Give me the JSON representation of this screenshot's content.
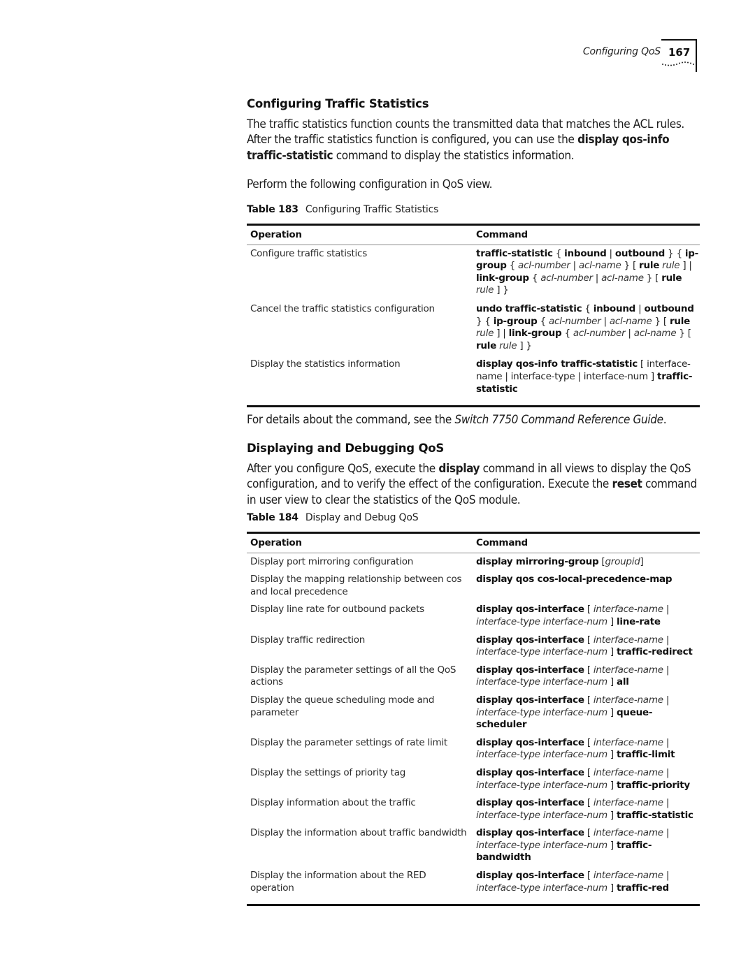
{
  "header": {
    "running_title": "Configuring QoS",
    "page_number": "167"
  },
  "section1": {
    "title": "Configuring Traffic Statistics",
    "intro": [
      {
        "t": "The traffic statistics function counts the transmitted data that matches the ACL rules. After the traffic statistics function is configured, you can use the ",
        "s": "n"
      },
      {
        "t": "display qos-info traffic-statistic",
        "s": "b"
      },
      {
        "t": " command to display the statistics information.",
        "s": "n"
      }
    ],
    "instruction": "Perform the following configuration in QoS view.",
    "table_label": "Table 183",
    "table_caption": "Configuring Traffic Statistics",
    "columns": [
      "Operation",
      "Command"
    ],
    "rows": [
      {
        "operation": "Configure traffic statistics",
        "command": [
          {
            "t": "traffic-statistic",
            "s": "b"
          },
          {
            "t": " { ",
            "s": "n"
          },
          {
            "t": "inbound",
            "s": "b"
          },
          {
            "t": " | ",
            "s": "n"
          },
          {
            "t": "outbound",
            "s": "b"
          },
          {
            "t": " } { ",
            "s": "n"
          },
          {
            "t": "ip-group",
            "s": "b"
          },
          {
            "t": " { ",
            "s": "n"
          },
          {
            "t": "acl-number",
            "s": "i"
          },
          {
            "t": " | ",
            "s": "n"
          },
          {
            "t": "acl-name",
            "s": "i"
          },
          {
            "t": " } [ ",
            "s": "n"
          },
          {
            "t": "rule",
            "s": "b"
          },
          {
            "t": " ",
            "s": "n"
          },
          {
            "t": "rule",
            "s": "i"
          },
          {
            "t": " ] | ",
            "s": "n"
          },
          {
            "t": "link-group",
            "s": "b"
          },
          {
            "t": " { ",
            "s": "n"
          },
          {
            "t": "acl-number",
            "s": "i"
          },
          {
            "t": " | ",
            "s": "n"
          },
          {
            "t": "acl-name",
            "s": "i"
          },
          {
            "t": " } [ ",
            "s": "n"
          },
          {
            "t": "rule",
            "s": "b"
          },
          {
            "t": " ",
            "s": "n"
          },
          {
            "t": "rule",
            "s": "i"
          },
          {
            "t": " ] }",
            "s": "n"
          }
        ]
      },
      {
        "operation": "Cancel the traffic statistics configuration",
        "command": [
          {
            "t": "undo traffic-statistic",
            "s": "b"
          },
          {
            "t": "  { ",
            "s": "n"
          },
          {
            "t": "inbound",
            "s": "b"
          },
          {
            "t": " | ",
            "s": "n"
          },
          {
            "t": "outbound",
            "s": "b"
          },
          {
            "t": " } { ",
            "s": "n"
          },
          {
            "t": "ip-group",
            "s": "b"
          },
          {
            "t": " { ",
            "s": "n"
          },
          {
            "t": "acl-number",
            "s": "i"
          },
          {
            "t": " | ",
            "s": "n"
          },
          {
            "t": "acl-name",
            "s": "i"
          },
          {
            "t": " } [ ",
            "s": "n"
          },
          {
            "t": "rule",
            "s": "b"
          },
          {
            "t": " ",
            "s": "n"
          },
          {
            "t": "rule",
            "s": "i"
          },
          {
            "t": " ] | ",
            "s": "n"
          },
          {
            "t": "link-group",
            "s": "b"
          },
          {
            "t": " { ",
            "s": "n"
          },
          {
            "t": "acl-number",
            "s": "i"
          },
          {
            "t": " | ",
            "s": "n"
          },
          {
            "t": "acl-name",
            "s": "i"
          },
          {
            "t": " } [ ",
            "s": "n"
          },
          {
            "t": "rule",
            "s": "b"
          },
          {
            "t": " ",
            "s": "n"
          },
          {
            "t": "rule",
            "s": "i"
          },
          {
            "t": " ] }",
            "s": "n"
          }
        ]
      },
      {
        "operation": "Display the statistics information",
        "command": [
          {
            "t": "display qos-info traffic-statistic",
            "s": "b"
          },
          {
            "t": " [ interface-name | interface-type | interface-num ] ",
            "s": "n"
          },
          {
            "t": "traffic-statistic",
            "s": "b"
          }
        ]
      }
    ],
    "reference": [
      {
        "t": "For details about the command, see the ",
        "s": "n"
      },
      {
        "t": "Switch 7750 Command Reference Guide",
        "s": "i"
      },
      {
        "t": ".",
        "s": "n"
      }
    ]
  },
  "section2": {
    "title": "Displaying and Debugging QoS",
    "intro": [
      {
        "t": "After you configure QoS, execute the ",
        "s": "n"
      },
      {
        "t": "display",
        "s": "b"
      },
      {
        "t": " command in all views to display the QoS configuration, and to verify the effect of the configuration. Execute the ",
        "s": "n"
      },
      {
        "t": "reset",
        "s": "b"
      },
      {
        "t": " command in user view to clear the statistics of the QoS module.",
        "s": "n"
      }
    ],
    "table_label": "Table 184",
    "table_caption": "Display and Debug QoS",
    "columns": [
      "Operation",
      "Command"
    ],
    "rows": [
      {
        "operation": "Display port mirroring configuration",
        "command": [
          {
            "t": "display mirroring-group",
            "s": "b"
          },
          {
            "t": " [",
            "s": "n"
          },
          {
            "t": "groupid",
            "s": "i"
          },
          {
            "t": "]",
            "s": "n"
          }
        ]
      },
      {
        "operation": "Display the mapping relationship between cos and local precedence",
        "command": [
          {
            "t": "display qos cos-local-precedence-map",
            "s": "b"
          }
        ]
      },
      {
        "operation": "Display line rate for outbound packets",
        "command": [
          {
            "t": "display qos-interface",
            "s": "b"
          },
          {
            "t": " [ ",
            "s": "n"
          },
          {
            "t": "interface-name",
            "s": "i"
          },
          {
            "t": " | ",
            "s": "n"
          },
          {
            "t": "interface-type interface-num",
            "s": "i"
          },
          {
            "t": " ] ",
            "s": "n"
          },
          {
            "t": "line-rate",
            "s": "b"
          }
        ]
      },
      {
        "operation": "Display traffic redirection",
        "command": [
          {
            "t": "display qos-interface",
            "s": "b"
          },
          {
            "t": " [ ",
            "s": "n"
          },
          {
            "t": "interface-name",
            "s": "i"
          },
          {
            "t": " | ",
            "s": "n"
          },
          {
            "t": "interface-type interface-num",
            "s": "i"
          },
          {
            "t": " ] ",
            "s": "n"
          },
          {
            "t": "traffic-redirect",
            "s": "b"
          }
        ]
      },
      {
        "operation": "Display the parameter settings of all the QoS actions",
        "command": [
          {
            "t": "display qos-interface",
            "s": "b"
          },
          {
            "t": " [ ",
            "s": "n"
          },
          {
            "t": "interface-name",
            "s": "i"
          },
          {
            "t": " | ",
            "s": "n"
          },
          {
            "t": "interface-type interface-num",
            "s": "i"
          },
          {
            "t": " ] ",
            "s": "n"
          },
          {
            "t": "all",
            "s": "b"
          }
        ]
      },
      {
        "operation": "Display the queue scheduling mode and parameter",
        "command": [
          {
            "t": "display qos-interface",
            "s": "b"
          },
          {
            "t": " [ ",
            "s": "n"
          },
          {
            "t": "interface-name",
            "s": "i"
          },
          {
            "t": " | ",
            "s": "n"
          },
          {
            "t": "interface-type interface-num",
            "s": "i"
          },
          {
            "t": " ] ",
            "s": "n"
          },
          {
            "t": "queue-scheduler",
            "s": "b"
          }
        ]
      },
      {
        "operation": "Display the parameter settings of rate limit",
        "command": [
          {
            "t": "display qos-interface",
            "s": "b"
          },
          {
            "t": " [ ",
            "s": "n"
          },
          {
            "t": "interface-name",
            "s": "i"
          },
          {
            "t": " | ",
            "s": "n"
          },
          {
            "t": "interface-type interface-num",
            "s": "i"
          },
          {
            "t": " ] ",
            "s": "n"
          },
          {
            "t": "traffic-limit",
            "s": "b"
          }
        ]
      },
      {
        "operation": "Display the settings of priority tag",
        "command": [
          {
            "t": "display qos-interface",
            "s": "b"
          },
          {
            "t": " [ ",
            "s": "n"
          },
          {
            "t": "interface-name",
            "s": "i"
          },
          {
            "t": " | ",
            "s": "n"
          },
          {
            "t": "interface-type interface-num",
            "s": "i"
          },
          {
            "t": " ] ",
            "s": "n"
          },
          {
            "t": "traffic-priority",
            "s": "b"
          }
        ]
      },
      {
        "operation": "Display information about the traffic",
        "command": [
          {
            "t": "display qos-interface",
            "s": "b"
          },
          {
            "t": " [ ",
            "s": "n"
          },
          {
            "t": "interface-name",
            "s": "i"
          },
          {
            "t": " | ",
            "s": "n"
          },
          {
            "t": "interface-type interface-num",
            "s": "i"
          },
          {
            "t": " ] ",
            "s": "n"
          },
          {
            "t": "traffic-statistic",
            "s": "b"
          }
        ]
      },
      {
        "operation": "Display the information about traffic bandwidth",
        "command": [
          {
            "t": "display qos-interface",
            "s": "b"
          },
          {
            "t": " [ ",
            "s": "n"
          },
          {
            "t": "interface-name",
            "s": "i"
          },
          {
            "t": " | ",
            "s": "n"
          },
          {
            "t": "interface-type interface-num",
            "s": "i"
          },
          {
            "t": " ] ",
            "s": "n"
          },
          {
            "t": "traffic-bandwidth",
            "s": "b"
          }
        ]
      },
      {
        "operation": "Display the information about the RED operation",
        "command": [
          {
            "t": "display qos-interface",
            "s": "b"
          },
          {
            "t": " [ ",
            "s": "n"
          },
          {
            "t": "interface-name",
            "s": "i"
          },
          {
            "t": " | ",
            "s": "n"
          },
          {
            "t": "interface-type interface-num",
            "s": "i"
          },
          {
            "t": " ] ",
            "s": "n"
          },
          {
            "t": "traffic-red",
            "s": "b"
          }
        ]
      }
    ]
  }
}
